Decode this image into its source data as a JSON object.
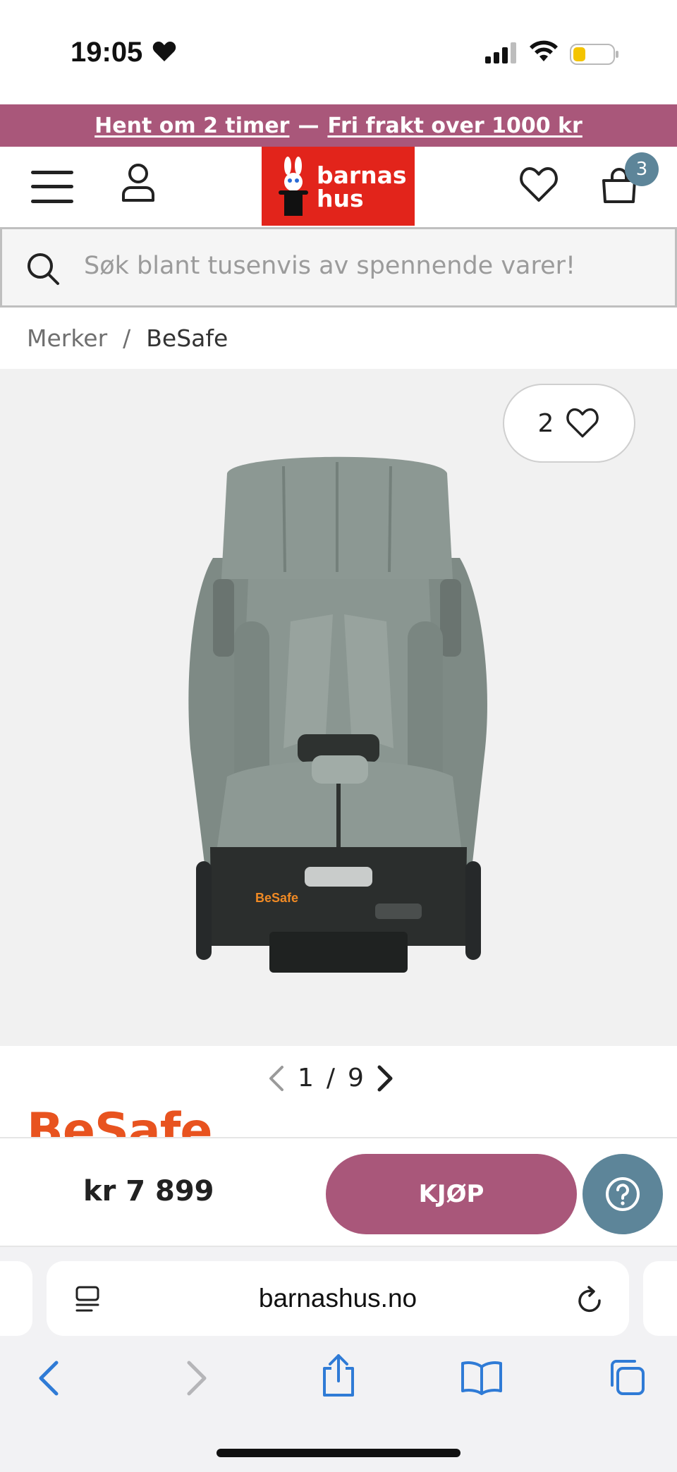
{
  "status_bar": {
    "time": "19:05"
  },
  "promo": {
    "pickup": "Hent om 2 timer",
    "separator": "—",
    "shipping": "Fri frakt over 1000 kr"
  },
  "header": {
    "logo_line1": "barnas",
    "logo_line2": "hus",
    "cart_count": "3",
    "icons": [
      "menu-icon",
      "user-icon",
      "heart-icon",
      "cart-icon"
    ]
  },
  "search": {
    "placeholder": "Søk blant tusenvis av spennende varer!"
  },
  "breadcrumb": {
    "items": [
      "Merker",
      "BeSafe"
    ],
    "separator": "/"
  },
  "gallery": {
    "favorite_count": "2",
    "current": "1",
    "separator": "/",
    "total": "9",
    "seat_brand_label": "BeSafe"
  },
  "brand": {
    "name": "BeSafe",
    "color": "#e8531f"
  },
  "buy_bar": {
    "price": "kr 7 899",
    "buy_label": "KJØP"
  },
  "browser": {
    "url": "barnashus.no"
  },
  "colors": {
    "accent": "#a9577a",
    "logo_red": "#e2241b",
    "help_blue": "#5d8599",
    "ios_blue": "#2f7bd6"
  }
}
